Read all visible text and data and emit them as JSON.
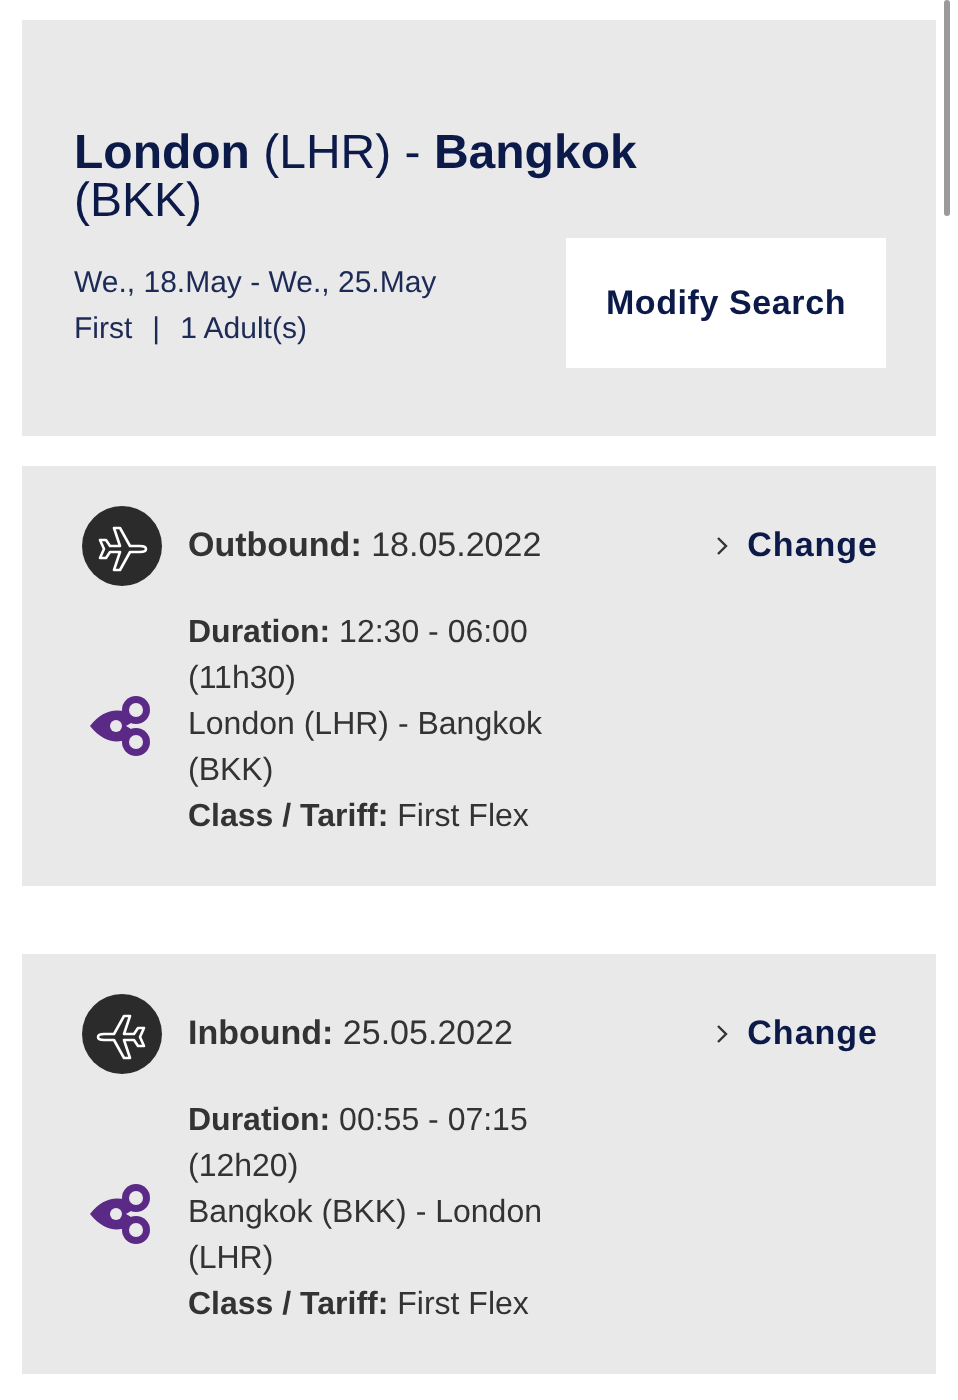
{
  "header": {
    "title": "**London** (LHR) - **Bangkok** (BKK)",
    "dates": "We., 18.May - We., 25.May",
    "travel_class": "First",
    "separator": "|",
    "passengers": "1 Adult(s)",
    "button": "Modify Search"
  },
  "flights": [
    {
      "kind": "outbound",
      "label": "**Outbound:** 18.05.2022",
      "change": "Change",
      "duration": "**Duration:** 12:30 - 06:00 (11h30)",
      "route": "London (LHR) - Bangkok (BKK)",
      "tariff": "**Class / Tariff:** First Flex"
    },
    {
      "kind": "inbound",
      "label": "**Inbound:** 25.05.2022",
      "change": "Change",
      "duration": "**Duration:** 00:55 - 07:15 (12h20)",
      "route": "Bangkok (BKK) - London (LHR)",
      "tariff": "**Class / Tariff:** First Flex"
    }
  ]
}
